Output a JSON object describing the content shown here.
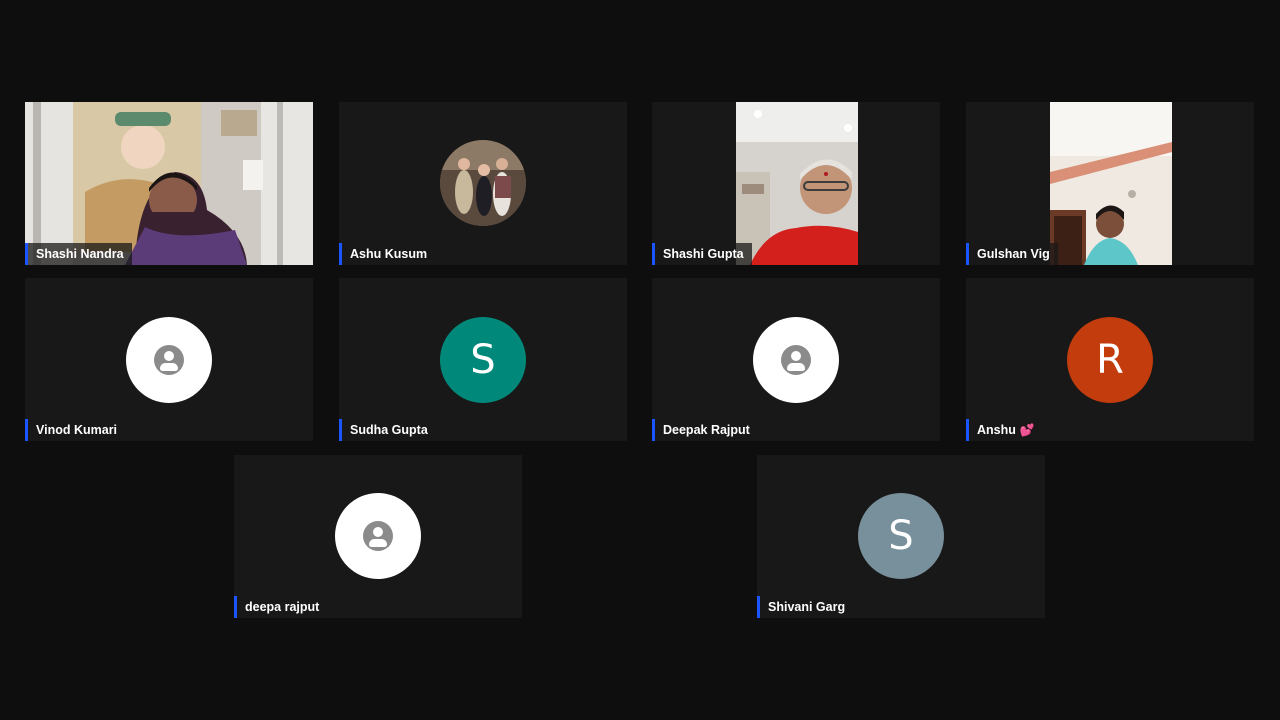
{
  "participants": [
    {
      "name": "Shashi Nandra"
    },
    {
      "name": "Ashu Kusum"
    },
    {
      "name": "Shashi Gupta"
    },
    {
      "name": "Gulshan Vig"
    },
    {
      "name": "Vinod Kumari"
    },
    {
      "name": "Sudha Gupta",
      "initial": "S",
      "color": "#00897b"
    },
    {
      "name": "Deepak Rajput"
    },
    {
      "name": "Anshu",
      "emoji": "💕",
      "initial": "R",
      "color": "#c23c0d"
    },
    {
      "name": "deepa rajput"
    },
    {
      "name": "Shivani Garg",
      "initial": "S",
      "color": "#78909c"
    }
  ],
  "colors": {
    "background": "#0e0e0e",
    "tile": "#181818",
    "name_accent": "#1a55ff"
  },
  "icons": {
    "no_photo_avatar": "person-icon"
  }
}
